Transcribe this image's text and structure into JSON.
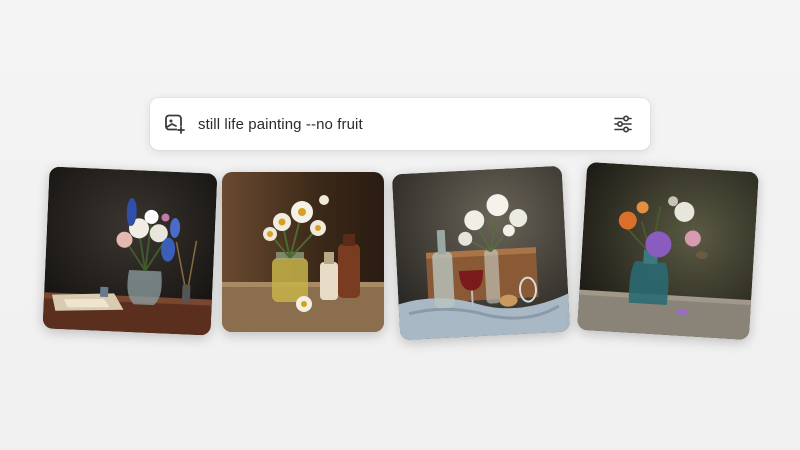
{
  "prompt": {
    "text": "still life painting --no fruit",
    "lead_icon": "add-image-icon",
    "settings_icon": "sliders-icon"
  },
  "gallery": {
    "images": [
      {
        "subject": "blue and white flowers in glass vase with brushes and papers on table"
      },
      {
        "subject": "daisies in glass jar with small bottles on wooden ledge"
      },
      {
        "subject": "white flowers with wine bottle, glass and cork on draped cloth"
      },
      {
        "subject": "purple and orange flowers in teal glass bottle"
      }
    ]
  },
  "colors": {
    "background": "#f2f2f2",
    "prompt_bg": "#ffffff",
    "text": "#2b2b2b",
    "icon": "#3a3a3a"
  }
}
